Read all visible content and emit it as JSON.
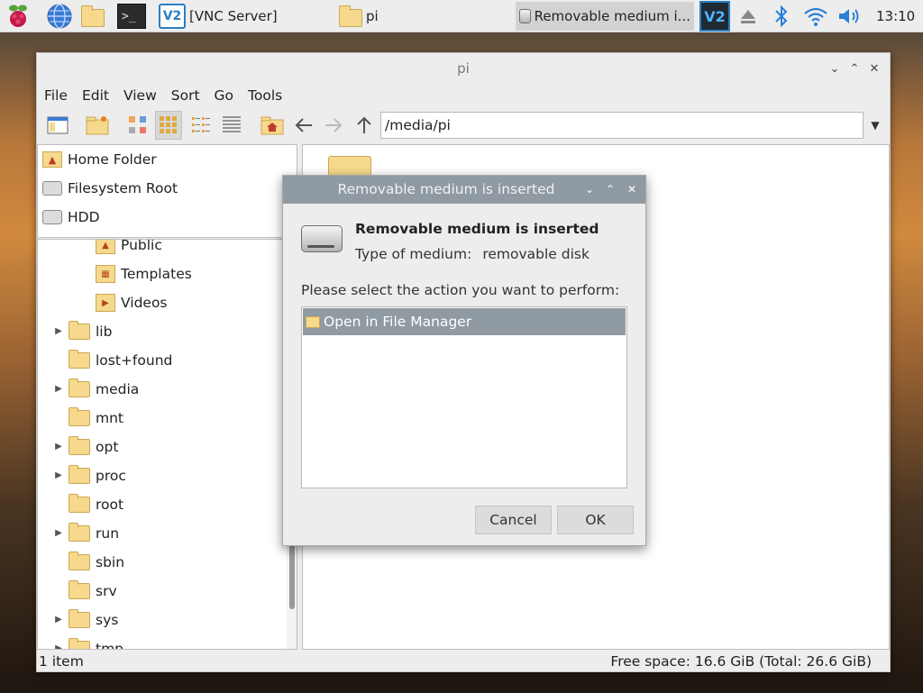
{
  "taskbar": {
    "menu_icon": "raspberry-icon",
    "browser_icon": "globe-icon",
    "files_icon": "folder-icon",
    "terminal_icon": "terminal-icon",
    "tasks": [
      {
        "label": "[VNC Server]",
        "icon": "vnc-icon"
      },
      {
        "label": "pi",
        "icon": "folder-icon"
      },
      {
        "label": "Removable medium i...",
        "icon": "drive-icon"
      }
    ],
    "tray": [
      "vnc-tray-icon",
      "eject-icon",
      "bluetooth-icon",
      "wifi-icon",
      "volume-icon"
    ],
    "clock": "13:10"
  },
  "file_manager": {
    "title": "pi",
    "menu": [
      "File",
      "Edit",
      "View",
      "Sort",
      "Go",
      "Tools"
    ],
    "path": "/media/pi",
    "places": [
      {
        "label": "Home Folder",
        "icon": "home-icon"
      },
      {
        "label": "Filesystem Root",
        "icon": "drive-icon"
      },
      {
        "label": "HDD",
        "icon": "drive-icon"
      }
    ],
    "tree": [
      {
        "label": "Public",
        "icon": "public-folder-icon",
        "expandable": false
      },
      {
        "label": "Templates",
        "icon": "templates-folder-icon",
        "expandable": false
      },
      {
        "label": "Videos",
        "icon": "videos-folder-icon",
        "expandable": false
      },
      {
        "label": "lib",
        "expandable": true
      },
      {
        "label": "lost+found",
        "expandable": false
      },
      {
        "label": "media",
        "expandable": true
      },
      {
        "label": "mnt",
        "expandable": false
      },
      {
        "label": "opt",
        "expandable": true
      },
      {
        "label": "proc",
        "expandable": true
      },
      {
        "label": "root",
        "expandable": false
      },
      {
        "label": "run",
        "expandable": true
      },
      {
        "label": "sbin",
        "expandable": false
      },
      {
        "label": "srv",
        "expandable": false
      },
      {
        "label": "sys",
        "expandable": true
      },
      {
        "label": "tmp",
        "expandable": true
      }
    ],
    "status_left": "1 item",
    "status_right": "Free space: 16.6 GiB (Total: 26.6 GiB)"
  },
  "dialog": {
    "title": "Removable medium is inserted",
    "heading": "Removable medium is inserted",
    "type_label": "Type of medium:",
    "type_value": "removable disk",
    "prompt": "Please select the action you want to perform:",
    "actions": [
      "Open in File Manager"
    ],
    "cancel_label": "Cancel",
    "ok_label": "OK"
  },
  "colors": {
    "selection": "#8f9aa3",
    "folder": "#f6d98c",
    "panel": "#ededed"
  }
}
